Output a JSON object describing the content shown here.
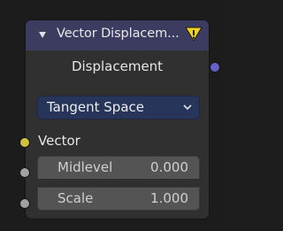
{
  "node": {
    "title": "Vector Displacem...",
    "header_color": "#3b3c5f",
    "collapse_icon": "triangle-down-icon",
    "warning_icon": "warning-icon"
  },
  "outputs": {
    "displacement_label": "Displacement",
    "socket_color": "#6363c7"
  },
  "space_dropdown": {
    "selected": "Tangent Space",
    "icon": "chevron-down-icon"
  },
  "inputs": {
    "vector_label": "Vector",
    "vector_socket_color": "#d1c13c",
    "midlevel": {
      "label": "Midlevel",
      "value": "0.000"
    },
    "scale": {
      "label": "Scale",
      "value": "1.000"
    },
    "float_socket_color": "#a1a1a1"
  }
}
